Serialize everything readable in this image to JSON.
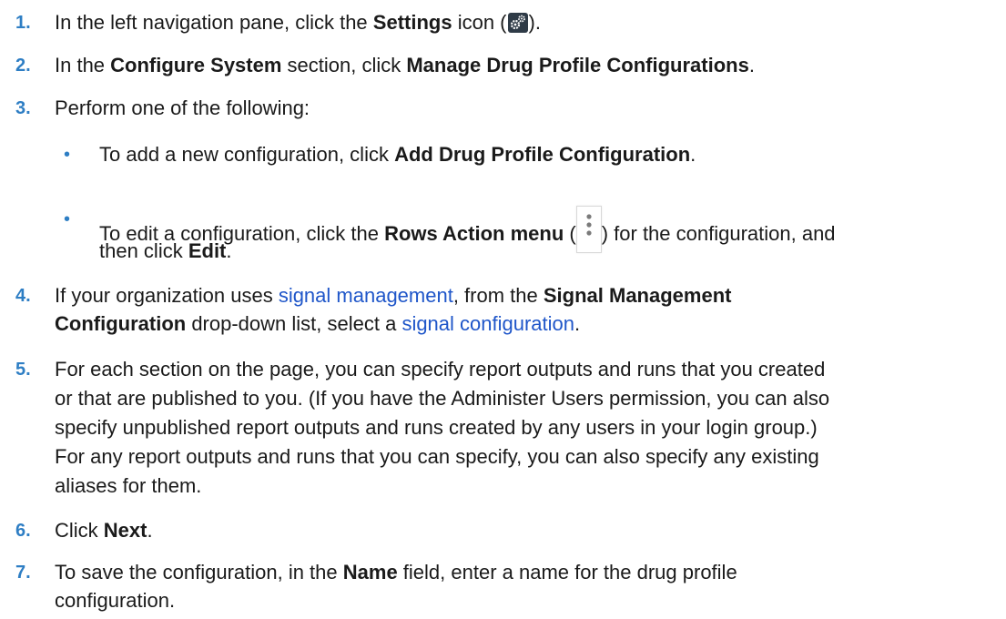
{
  "steps": [
    {
      "number": "1.",
      "parts": [
        "In the left navigation pane, click the ",
        "Settings",
        " icon (",
        ")."
      ]
    },
    {
      "number": "2.",
      "parts": [
        "In the ",
        "Configure System",
        " section, click ",
        "Manage Drug Profile Configurations",
        "."
      ]
    },
    {
      "number": "3.",
      "parts": [
        "Perform one of the following:"
      ],
      "bullets": [
        {
          "parts": [
            "To add a new configuration, click ",
            "Add Drug Profile Configuration",
            "."
          ]
        },
        {
          "parts": [
            "To edit a configuration, click the ",
            "Rows Action menu",
            " (",
            ") for the configuration, and",
            "then click ",
            "Edit",
            "."
          ]
        }
      ]
    },
    {
      "number": "4.",
      "parts": [
        "If your organization uses ",
        "signal management",
        ", from the ",
        "Signal Management",
        "Configuration",
        " drop-down list, select a ",
        "signal configuration",
        "."
      ]
    },
    {
      "number": "5.",
      "lines": [
        "For each section on the page, you can specify report outputs and runs that you created",
        "or that are published to you. (If you have the Administer Users permission, you can also",
        "specify unpublished report outputs and runs created by any users in your login group.)",
        "For any report outputs and runs that you can specify, you can also specify any existing",
        "aliases for them."
      ]
    },
    {
      "number": "6.",
      "parts": [
        "Click ",
        "Next",
        "."
      ]
    },
    {
      "number": "7.",
      "parts": [
        "To save the configuration, in the ",
        "Name",
        " field, enter a name for the drug profile",
        "configuration."
      ]
    }
  ],
  "bullet_char": "•",
  "icons": {
    "settings": "gear-icon",
    "rows_action": "kebab-menu-icon"
  },
  "colors": {
    "number": "#2e7ec4",
    "link": "#1f56c9",
    "text": "#1a1a1a"
  }
}
